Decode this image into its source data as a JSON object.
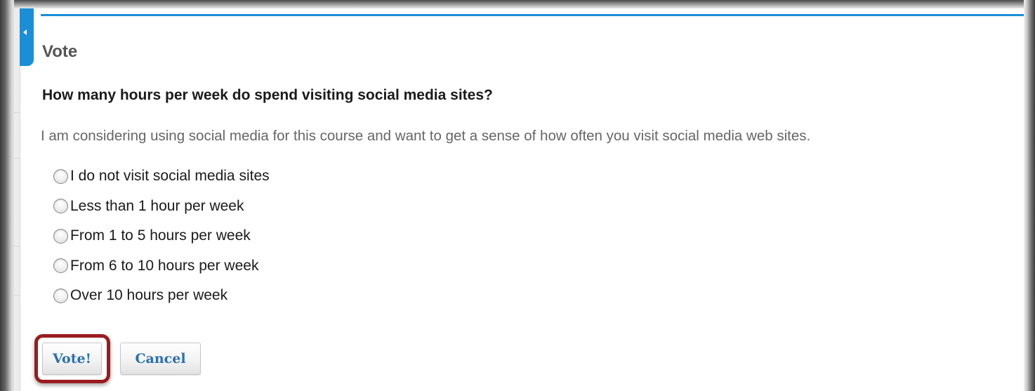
{
  "panel": {
    "title": "Vote"
  },
  "poll": {
    "question": "How many hours per week do spend visiting social media sites?",
    "description": "I am considering using social media for this course and want to get a sense of how often you visit social media web sites.",
    "options": [
      {
        "label": "I do not visit social media sites",
        "selected": false
      },
      {
        "label": "Less than 1 hour per week",
        "selected": false
      },
      {
        "label": "From 1 to 5 hours per week",
        "selected": false
      },
      {
        "label": "From 6 to 10 hours per week",
        "selected": false
      },
      {
        "label": "Over 10 hours per week",
        "selected": false
      }
    ]
  },
  "actions": {
    "vote_label": "Vote!",
    "cancel_label": "Cancel"
  },
  "colors": {
    "accent": "#1a8fd6",
    "button_text": "#2a6fb0",
    "highlight": "#9b1b1f"
  },
  "icons": {
    "collapse": "collapse-left-arrow-icon"
  }
}
